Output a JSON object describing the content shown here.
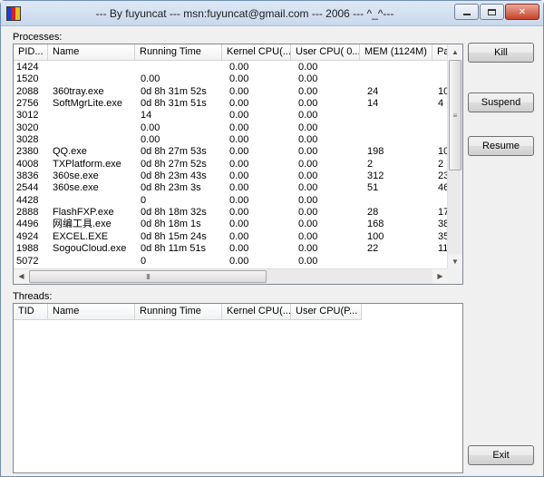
{
  "window": {
    "title": "--- By fuyuncat --- msn:fuyuncat@gmail.com --- 2006 --- ^_^---"
  },
  "processes": {
    "label": "Processes:",
    "columns": [
      "PID...",
      "Name",
      "Running Time",
      "Kernel CPU(...",
      "User CPU( 0...",
      "MEM (1124M)",
      "Pa"
    ],
    "rows": [
      {
        "pid": "1424",
        "name": "",
        "time": "",
        "kcpu": "0.00",
        "ucpu": "0.00",
        "mem": "",
        "pa": ""
      },
      {
        "pid": "1520",
        "name": "",
        "time": "0.00",
        "kcpu": "0.00",
        "ucpu": "0.00",
        "mem": "",
        "pa": ""
      },
      {
        "pid": "2088",
        "name": "360tray.exe",
        "time": "0d 8h 31m 52s",
        "kcpu": "0.00",
        "ucpu": "0.00",
        "mem": "24",
        "pa": "10"
      },
      {
        "pid": "2756",
        "name": "SoftMgrLite.exe",
        "time": "0d 8h 31m 51s",
        "kcpu": "0.00",
        "ucpu": "0.00",
        "mem": "14",
        "pa": "4"
      },
      {
        "pid": "3012",
        "name": "",
        "time": "14",
        "kcpu": "0.00",
        "ucpu": "0.00",
        "mem": "",
        "pa": ""
      },
      {
        "pid": "3020",
        "name": "",
        "time": "0.00",
        "kcpu": "0.00",
        "ucpu": "0.00",
        "mem": "",
        "pa": ""
      },
      {
        "pid": "3028",
        "name": "",
        "time": "0.00",
        "kcpu": "0.00",
        "ucpu": "0.00",
        "mem": "",
        "pa": ""
      },
      {
        "pid": "2380",
        "name": "QQ.exe",
        "time": "0d 8h 27m 53s",
        "kcpu": "0.00",
        "ucpu": "0.00",
        "mem": "198",
        "pa": "10"
      },
      {
        "pid": "4008",
        "name": "TXPlatform.exe",
        "time": "0d 8h 27m 52s",
        "kcpu": "0.00",
        "ucpu": "0.00",
        "mem": "2",
        "pa": "2"
      },
      {
        "pid": "3836",
        "name": "360se.exe",
        "time": "0d 8h 23m 43s",
        "kcpu": "0.00",
        "ucpu": "0.00",
        "mem": "312",
        "pa": "23"
      },
      {
        "pid": "2544",
        "name": "360se.exe",
        "time": "0d 8h 23m 3s",
        "kcpu": "0.00",
        "ucpu": "0.00",
        "mem": "51",
        "pa": "46"
      },
      {
        "pid": "4428",
        "name": "",
        "time": "0",
        "kcpu": "0.00",
        "ucpu": "0.00",
        "mem": "",
        "pa": ""
      },
      {
        "pid": "2888",
        "name": "FlashFXP.exe",
        "time": "0d 8h 18m 32s",
        "kcpu": "0.00",
        "ucpu": "0.00",
        "mem": "28",
        "pa": "17"
      },
      {
        "pid": "4496",
        "name": "网编工具.exe",
        "time": "0d 8h 18m 1s",
        "kcpu": "0.00",
        "ucpu": "0.00",
        "mem": "168",
        "pa": "38"
      },
      {
        "pid": "4924",
        "name": "EXCEL.EXE",
        "time": "0d 8h 15m 24s",
        "kcpu": "0.00",
        "ucpu": "0.00",
        "mem": "100",
        "pa": "35"
      },
      {
        "pid": "1988",
        "name": "SogouCloud.exe",
        "time": "0d 8h 11m 51s",
        "kcpu": "0.00",
        "ucpu": "0.00",
        "mem": "22",
        "pa": "11"
      },
      {
        "pid": "5072",
        "name": "",
        "time": "0",
        "kcpu": "0.00",
        "ucpu": "0.00",
        "mem": "",
        "pa": ""
      }
    ]
  },
  "threads": {
    "label": "Threads:",
    "columns": [
      "TID",
      "Name",
      "Running Time",
      "Kernel CPU(...",
      "User CPU(P..."
    ]
  },
  "buttons": {
    "kill": "Kill",
    "suspend": "Suspend",
    "resume": "Resume",
    "exit": "Exit"
  },
  "icons": {
    "app": "app-icon",
    "minimize": "minimize-icon",
    "maximize": "maximize-icon",
    "close": "close-icon",
    "scroll_up": "▲",
    "scroll_down": "▼",
    "scroll_left": "◀",
    "scroll_right": "▶",
    "grip_v": "≡",
    "grip_h": "III",
    "close_glyph": "✕"
  }
}
